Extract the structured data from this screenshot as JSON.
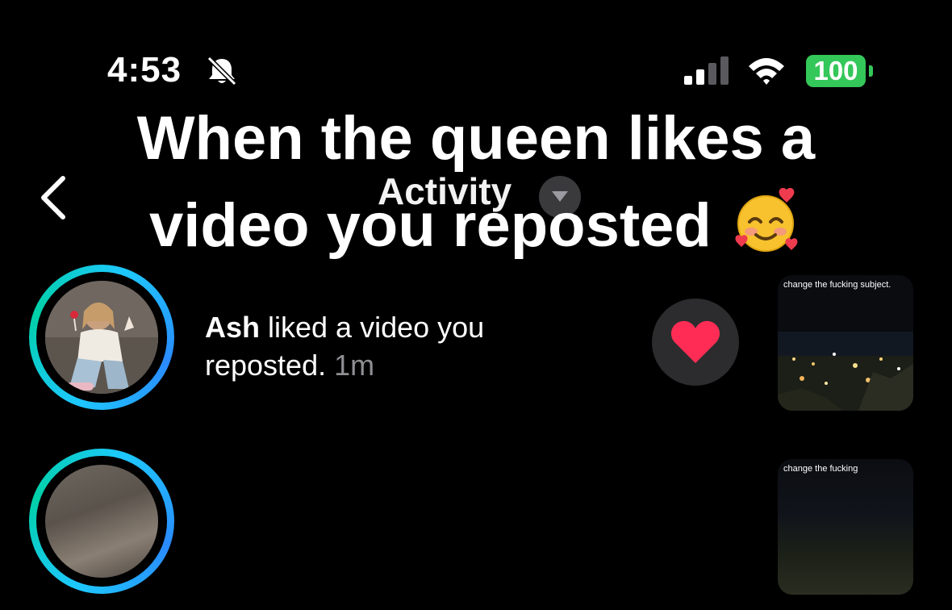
{
  "status_bar": {
    "time": "4:53",
    "battery": "100",
    "icons": [
      "bell-slash-icon",
      "cellular-signal-icon",
      "wifi-icon",
      "battery-icon"
    ]
  },
  "nav": {
    "title": "Activity",
    "icons": [
      "chevron-left-icon",
      "chevron-down-icon"
    ]
  },
  "overlay_caption": {
    "text": "When the queen likes a video you reposted",
    "emoji": "smiling-face-with-hearts"
  },
  "notifications": [
    {
      "username": "Ash",
      "message": " liked a video you reposted.",
      "time": "1m",
      "thumbnail_caption": "change the fucking subject."
    },
    {
      "thumbnail_caption": "change the fucking"
    }
  ],
  "colors": {
    "background": "#000000",
    "battery": "#34c759",
    "heart": "#ff2d55",
    "ring_start": "#1ec8ff",
    "ring_end": "#00d1a7"
  }
}
